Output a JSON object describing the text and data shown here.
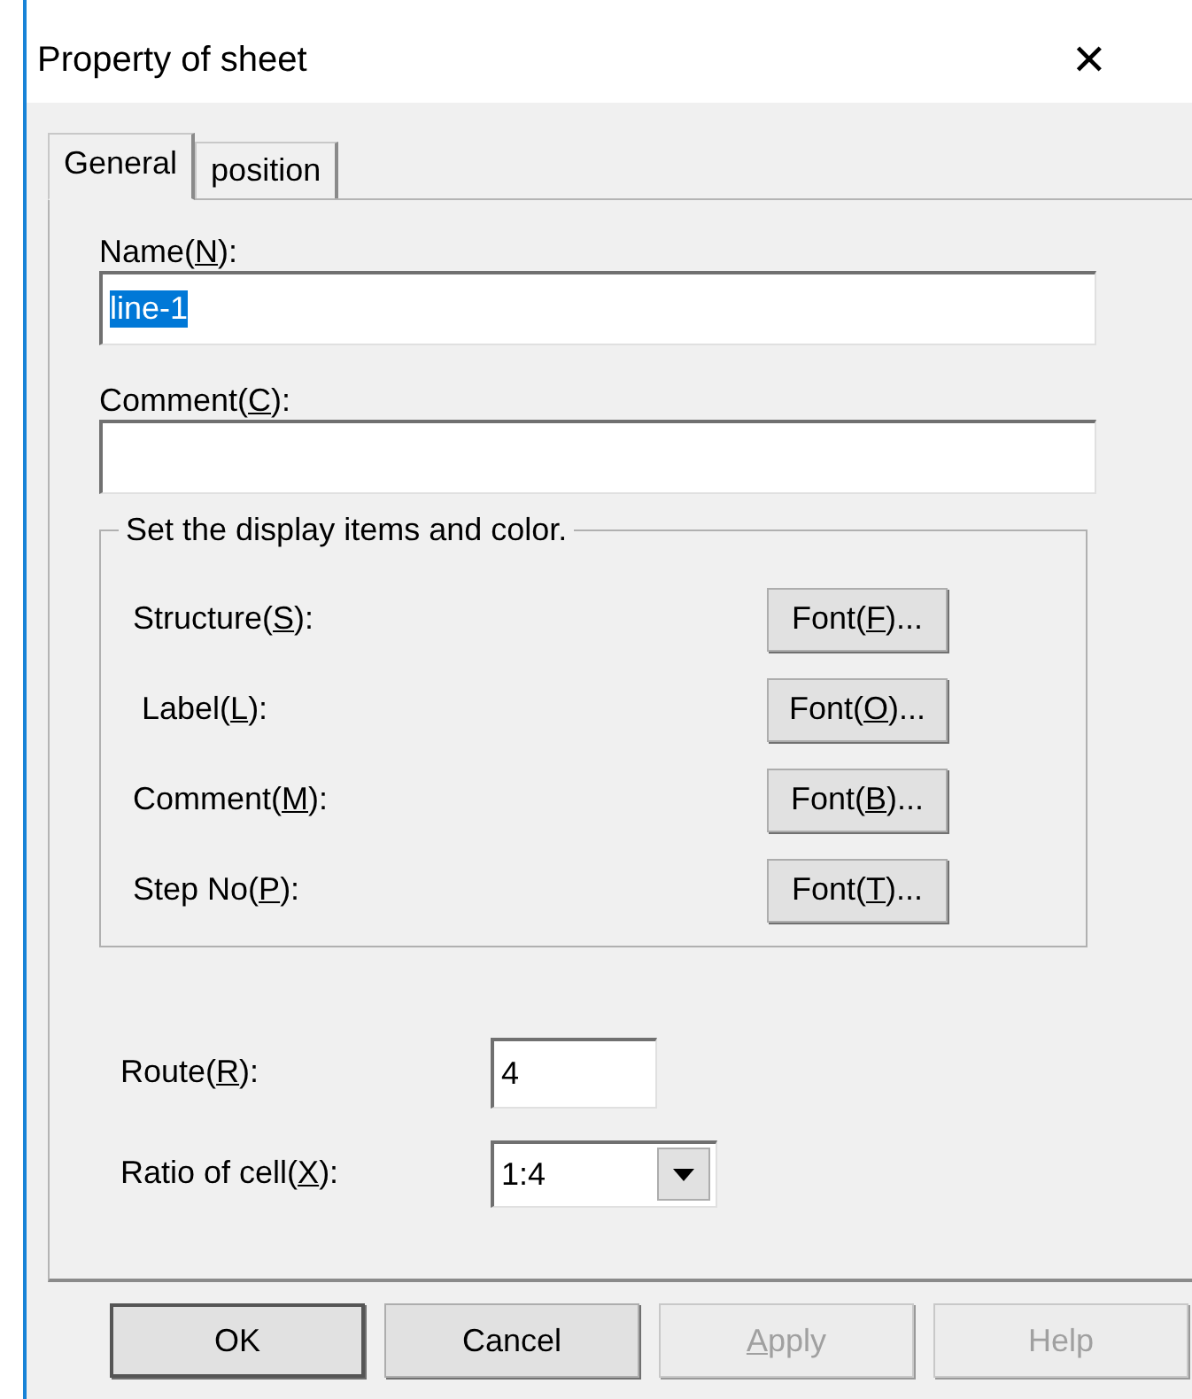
{
  "window": {
    "title": "Property of sheet",
    "close": "✕"
  },
  "tabs": [
    {
      "label": "General",
      "selected": true
    },
    {
      "label": "position",
      "selected": false
    }
  ],
  "fields": [
    {
      "label": {
        "pre": "Name(",
        "key": "N",
        "post": "):"
      },
      "value": "line-1",
      "selected_text": true
    },
    {
      "label": {
        "pre": "Comment(",
        "key": "C",
        "post": "):"
      }
    }
  ],
  "group": {
    "title": "Set the display items and color.",
    "rows": [
      {
        "label": {
          "pre": "Structure(",
          "key": "S",
          "post": "):"
        },
        "button": {
          "pre": "Font(",
          "key": "F",
          "post": ")..."
        }
      },
      {
        "label": {
          "pre": " Label(",
          "key": "L",
          "post": "):"
        },
        "button": {
          "pre": "Font(",
          "key": "O",
          "post": ")..."
        }
      },
      {
        "label": {
          "pre": "Comment(",
          "key": "M",
          "post": "):"
        },
        "button": {
          "pre": "Font(",
          "key": "B",
          "post": ")..."
        }
      },
      {
        "label": {
          "pre": "Step No(",
          "key": "P",
          "post": "):"
        },
        "button": {
          "pre": "Font(",
          "key": "T",
          "post": ")..."
        }
      }
    ]
  },
  "route": {
    "label": {
      "pre": "Route(",
      "key": "R",
      "post": "):"
    },
    "value": "4"
  },
  "ratio": {
    "label": {
      "pre": "Ratio of cell(",
      "key": "X",
      "post": "):"
    },
    "value": "1:4"
  },
  "buttons": [
    {
      "label": {
        "post": "OK"
      },
      "disabled": false,
      "default": true
    },
    {
      "label": {
        "post": "Cancel"
      },
      "disabled": false,
      "default": false
    },
    {
      "label": {
        "key": "A",
        "post": "pply"
      },
      "disabled": true,
      "default": false
    },
    {
      "label": {
        "post": "Help"
      },
      "disabled": true,
      "default": false
    }
  ]
}
